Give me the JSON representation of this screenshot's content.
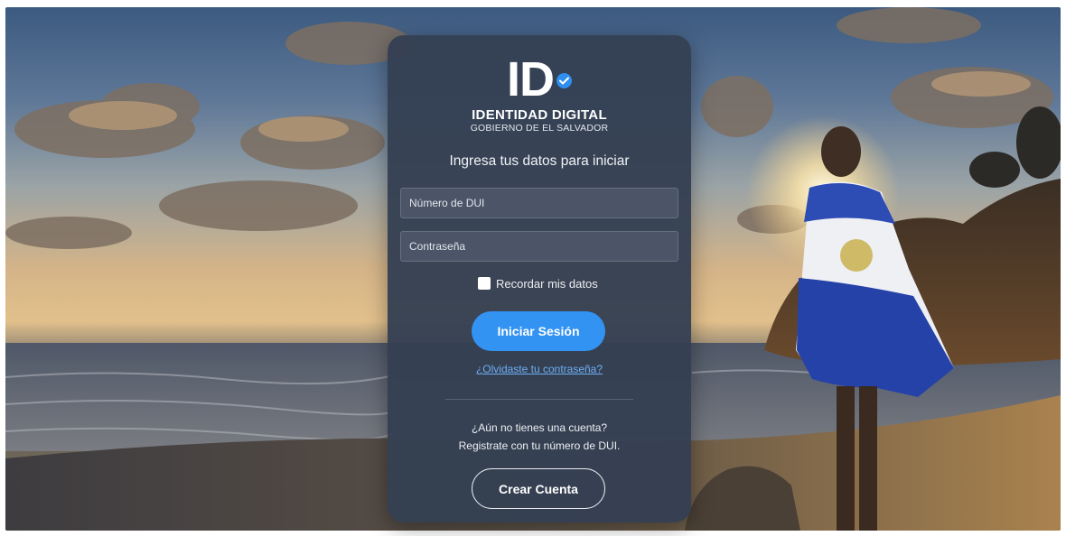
{
  "brand": {
    "logo_text": "ID",
    "title": "IDENTIDAD DIGITAL",
    "subtitle": "GOBIERNO DE EL SALVADOR"
  },
  "login": {
    "headline": "Ingresa tus datos para iniciar",
    "dui_placeholder": "Número de DUI",
    "password_placeholder": "Contraseña",
    "remember_label": "Recordar mis datos",
    "submit_label": "Iniciar Sesión",
    "forgot_link": "¿Olvidaste tu contraseña?"
  },
  "register": {
    "question": "¿Aún no tienes una cuenta?",
    "hint": "Registrate con tu número de DUI.",
    "button_label": "Crear Cuenta"
  },
  "colors": {
    "card_background": "#343f52",
    "primary_button": "#3393f2",
    "link": "#6eaef3",
    "verified_badge": "#2f8ff0"
  }
}
